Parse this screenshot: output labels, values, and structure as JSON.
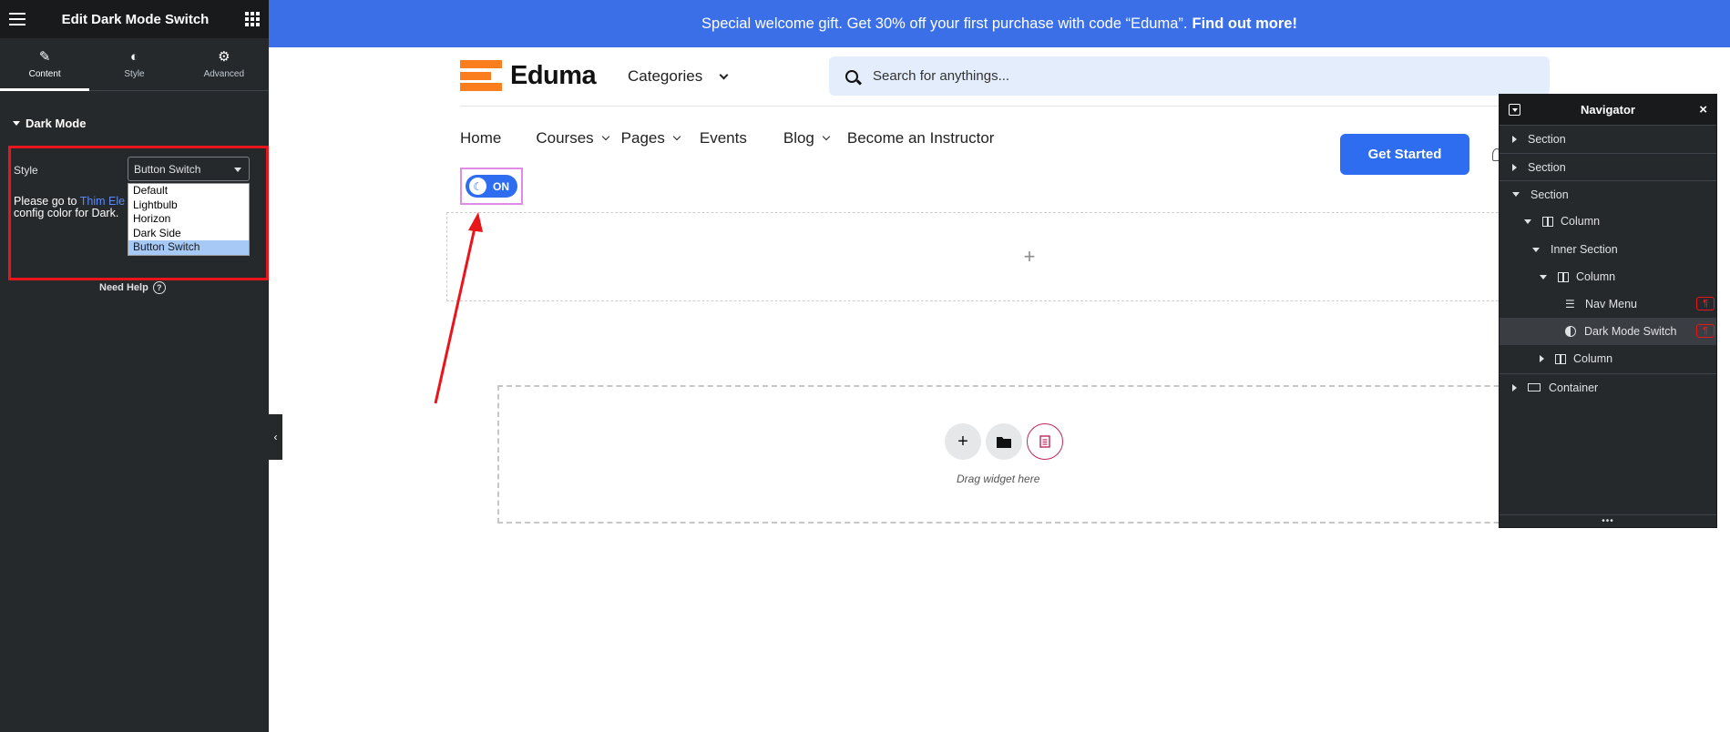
{
  "panel": {
    "title": "Edit Dark Mode Switch",
    "tabs": [
      {
        "label": "Content",
        "icon": "pencil-icon"
      },
      {
        "label": "Style",
        "icon": "half-circle-icon"
      },
      {
        "label": "Advanced",
        "icon": "gear-icon"
      }
    ],
    "section_title": "Dark Mode",
    "style_label": "Style",
    "style_value": "Button Switch",
    "style_options": [
      "Default",
      "Lightbulb",
      "Horizon",
      "Dark Side",
      "Button Switch"
    ],
    "note_prefix": "Please go to ",
    "note_link": "Thim Ele",
    "note_suffix": "config color for Dark.",
    "need_help": "Need Help",
    "help_icon_glyph": "?",
    "collapse_glyph": "‹"
  },
  "site": {
    "promo_text": "Special welcome gift. Get 30% off your first purchase with code “Eduma”.",
    "promo_link": "Find out more!",
    "logo_text": "Eduma",
    "categories_label": "Categories",
    "search_placeholder": "Search for anythings...",
    "nav_items": [
      {
        "label": "Home",
        "has_dropdown": false
      },
      {
        "label": "Courses",
        "has_dropdown": true
      },
      {
        "label": "Pages",
        "has_dropdown": true
      },
      {
        "label": "Events",
        "has_dropdown": false
      },
      {
        "label": "Blog",
        "has_dropdown": true
      },
      {
        "label": "Become an Instructor",
        "has_dropdown": false
      }
    ],
    "cta_label": "Get Started",
    "toggle_state": "ON",
    "add_section_glyph": "+",
    "drag_text": "Drag widget here",
    "accent_color": "#2e6df0",
    "logo_color": "#fa7d1e"
  },
  "navigator": {
    "title": "Navigator",
    "close_glyph": "×",
    "footer_glyph": "•••",
    "badge_glyph": "¶",
    "items": [
      {
        "label": "Section",
        "depth": 0,
        "expand": "right",
        "icon": "",
        "selected": false
      },
      {
        "label": "Section",
        "depth": 0,
        "expand": "right",
        "icon": "",
        "selected": false
      },
      {
        "label": "Section",
        "depth": 0,
        "expand": "down",
        "icon": "",
        "selected": false
      },
      {
        "label": "Column",
        "depth": 1,
        "expand": "down",
        "icon": "column-icon",
        "selected": false
      },
      {
        "label": "Inner Section",
        "depth": 2,
        "expand": "down",
        "icon": "",
        "selected": false
      },
      {
        "label": "Column",
        "depth": 3,
        "expand": "down",
        "icon": "column-icon",
        "selected": false
      },
      {
        "label": "Nav Menu",
        "depth": 4,
        "expand": "none",
        "icon": "nav-menu-icon",
        "selected": false,
        "badge": true
      },
      {
        "label": "Dark Mode Switch",
        "depth": 4,
        "expand": "none",
        "icon": "half-circle-icon",
        "selected": true,
        "badge": true
      },
      {
        "label": "Column",
        "depth": 3,
        "expand": "right",
        "icon": "column-icon",
        "selected": false
      },
      {
        "label": "Container",
        "depth": 0,
        "expand": "right",
        "icon": "container-icon",
        "selected": false
      }
    ]
  }
}
